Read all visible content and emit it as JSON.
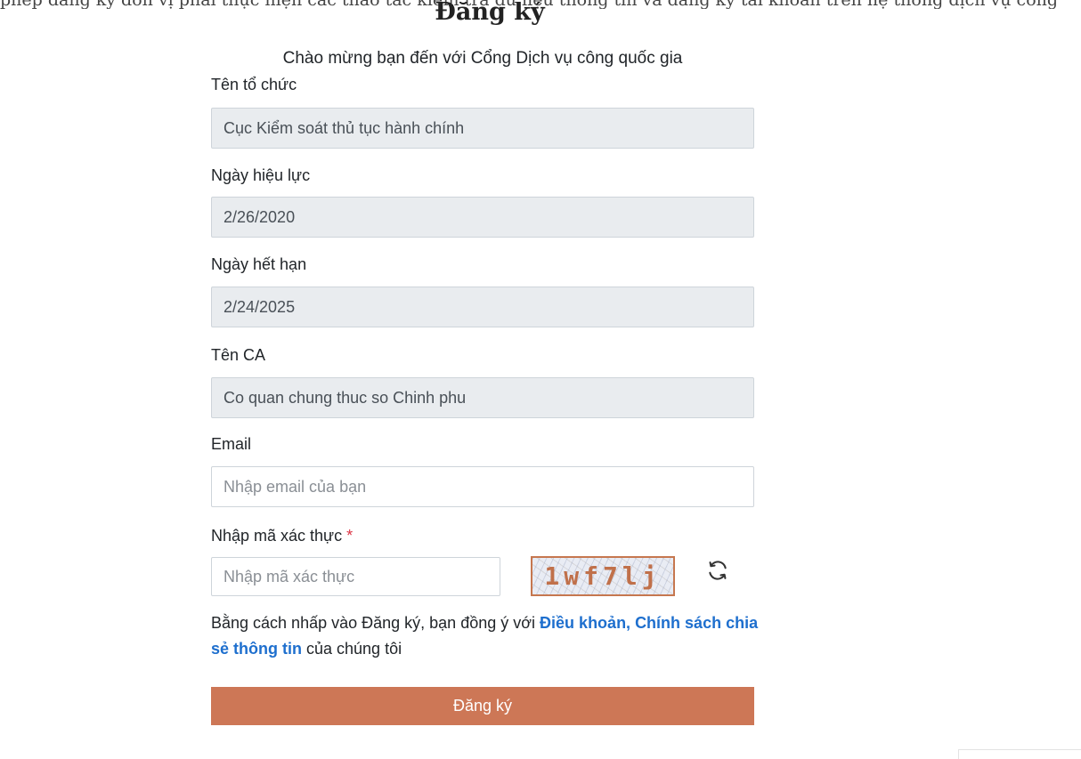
{
  "top_strip_text": "phép đăng ký đơn vị phải thực hiện các thao tác kiểm tra dữ liệu thông tin và đăng ký tài khoản trên hệ thống dịch vụ công",
  "title": "Đăng ký",
  "welcome": "Chào mừng bạn đến với Cổng Dịch vụ công quốc gia",
  "fields": {
    "org_name": {
      "label": "Tên tổ chức",
      "value": "Cục Kiểm soát thủ tục hành chính"
    },
    "effective_date": {
      "label": "Ngày hiệu lực",
      "value": "2/26/2020"
    },
    "expiry_date": {
      "label": "Ngày hết hạn",
      "value": "2/24/2025"
    },
    "ca_name": {
      "label": "Tên CA",
      "value": "Co quan chung thuc so Chinh phu"
    },
    "email": {
      "label": "Email",
      "placeholder": "Nhập email của bạn"
    },
    "captcha": {
      "label": "Nhập mã xác thực",
      "required_mark": "*",
      "placeholder": "Nhập mã xác thực",
      "image_text": "1wf7lj"
    }
  },
  "terms": {
    "prefix": "Bằng cách nhấp vào Đăng ký, bạn đồng ý với ",
    "link": "Điều khoản, Chính sách chia sẻ thông tin",
    "suffix": " của chúng tôi"
  },
  "submit_label": "Đăng ký",
  "icons": {
    "refresh": "refresh-icon"
  },
  "colors": {
    "accent": "#cd7756",
    "link": "#1e6fce",
    "required": "#dc3545",
    "readonly_bg": "#e9ecef"
  }
}
